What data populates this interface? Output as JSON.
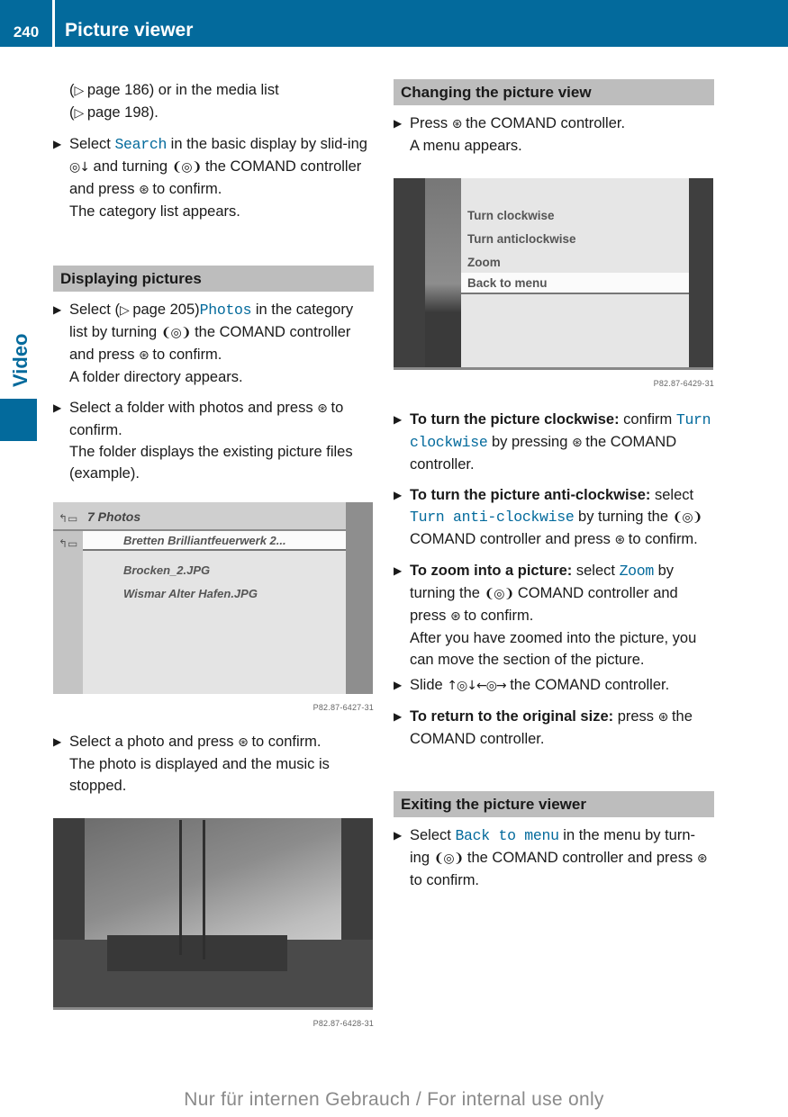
{
  "header": {
    "page_number": "240",
    "title": "Picture viewer",
    "color": "#036a9c"
  },
  "side_tab": {
    "label": "Video"
  },
  "icons": {
    "bullet": "▶",
    "press_controller": "⊛",
    "turn_controller": "❨◎❩",
    "slide_down": "◎↓",
    "slide_all": "↑◎↓←◎→",
    "page_ref": "▷"
  },
  "left_column": {
    "intro": {
      "line1_pre": "(",
      "line1_ref": "page 186) or in the media list",
      "line2_pre": "(",
      "line2_ref": "page 198)."
    },
    "step_search": {
      "t1": "Select ",
      "kw": "Search",
      "t2": " in the basic display by slid-ing ",
      "t3": " and turning ",
      "t4": " the COMAND controller and press ",
      "t5": " to confirm.",
      "result": "The category list appears."
    },
    "section_displaying": {
      "title": "Displaying pictures",
      "step1": {
        "t1": "Select (",
        "t2": "page 205)",
        "kw": "Photos",
        "t3": " in the category list by turning ",
        "t4": " the COMAND controller and press ",
        "t5": " to confirm.",
        "result": "A folder directory appears."
      },
      "step2": {
        "t1": "Select a folder with photos and press ",
        "t2": " to confirm.",
        "result": "The folder displays the existing picture files (example)."
      },
      "folder_screen": {
        "title": "7 Photos",
        "items": [
          {
            "label": "Bretten Brilliantfeuerwerk 2...",
            "selected": true
          },
          {
            "label": "Brocken_2.JPG",
            "selected": false
          },
          {
            "label": "Wismar Alter Hafen.JPG",
            "selected": false
          }
        ],
        "caption": "P82.87-6427-31"
      },
      "step3": {
        "t1": "Select a photo and press ",
        "t2": " to confirm.",
        "result": "The photo is displayed and the music is stopped."
      },
      "photo_screen": {
        "caption": "P82.87-6428-31"
      }
    }
  },
  "right_column": {
    "section_changing": {
      "title": "Changing the picture view",
      "step1": {
        "t1": "Press ",
        "t2": " the COMAND controller.",
        "result": "A menu appears."
      },
      "menu_screen": {
        "items": [
          {
            "label": "Turn clockwise",
            "selected": false
          },
          {
            "label": "Turn anticlockwise",
            "selected": false
          },
          {
            "label": "Zoom",
            "selected": false
          },
          {
            "label": "Back to menu",
            "selected": true
          }
        ],
        "caption": "P82.87-6429-31"
      },
      "step_clockwise": {
        "bold": "To turn the picture clockwise:",
        "t1": " confirm ",
        "kw": "Turn clockwise",
        "t2": " by pressing ",
        "t3": " the COMAND controller."
      },
      "step_anticlockwise": {
        "bold": "To turn the picture anti-clockwise:",
        "t1": " select ",
        "kw": "Turn anti-clockwise",
        "t2": " by turning the ",
        "t3": " COMAND controller and press ",
        "t4": " to confirm."
      },
      "step_zoom": {
        "bold": "To zoom into a picture:",
        "t1": " select ",
        "kw": "Zoom",
        "t2": " by turning the ",
        "t3": " COMAND controller and press ",
        "t4": " to confirm.",
        "result": "After you have zoomed into the picture, you can move the section of the picture."
      },
      "step_slide": {
        "t1": "Slide ",
        "t2": " the COMAND controller."
      },
      "step_original": {
        "bold": "To return to the original size:",
        "t1": " press ",
        "t2": " the COMAND controller."
      }
    },
    "section_exiting": {
      "title": "Exiting the picture viewer",
      "step1": {
        "t1": "Select ",
        "kw": "Back to menu",
        "t2": " in the menu by turn-ing ",
        "t3": " the COMAND controller and press ",
        "t4": " to confirm."
      }
    }
  },
  "footer": {
    "text": "Nur für internen Gebrauch / For internal use only"
  }
}
